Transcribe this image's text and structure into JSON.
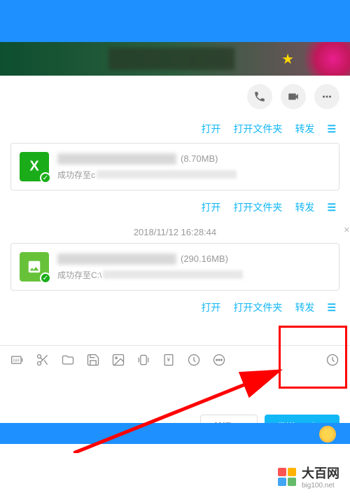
{
  "files": [
    {
      "size": "(8.70MB)",
      "status_prefix": "成功存至c",
      "icon_type": "X"
    },
    {
      "size": "(290.16MB)",
      "status_prefix": "成功存至C:\\",
      "icon_type": "image"
    }
  ],
  "actions": {
    "open": "打开",
    "open_folder": "打开文件夹",
    "forward": "转发"
  },
  "timestamp": "2018/11/12 16:28:44",
  "buttons": {
    "close": "关闭(C)",
    "send": "发送(S)"
  },
  "watermark": {
    "cn": "大百网",
    "en": "big100.net",
    "colors": [
      "#FF5252",
      "#FFB300",
      "#42A5F5",
      "#66BB6A"
    ]
  }
}
